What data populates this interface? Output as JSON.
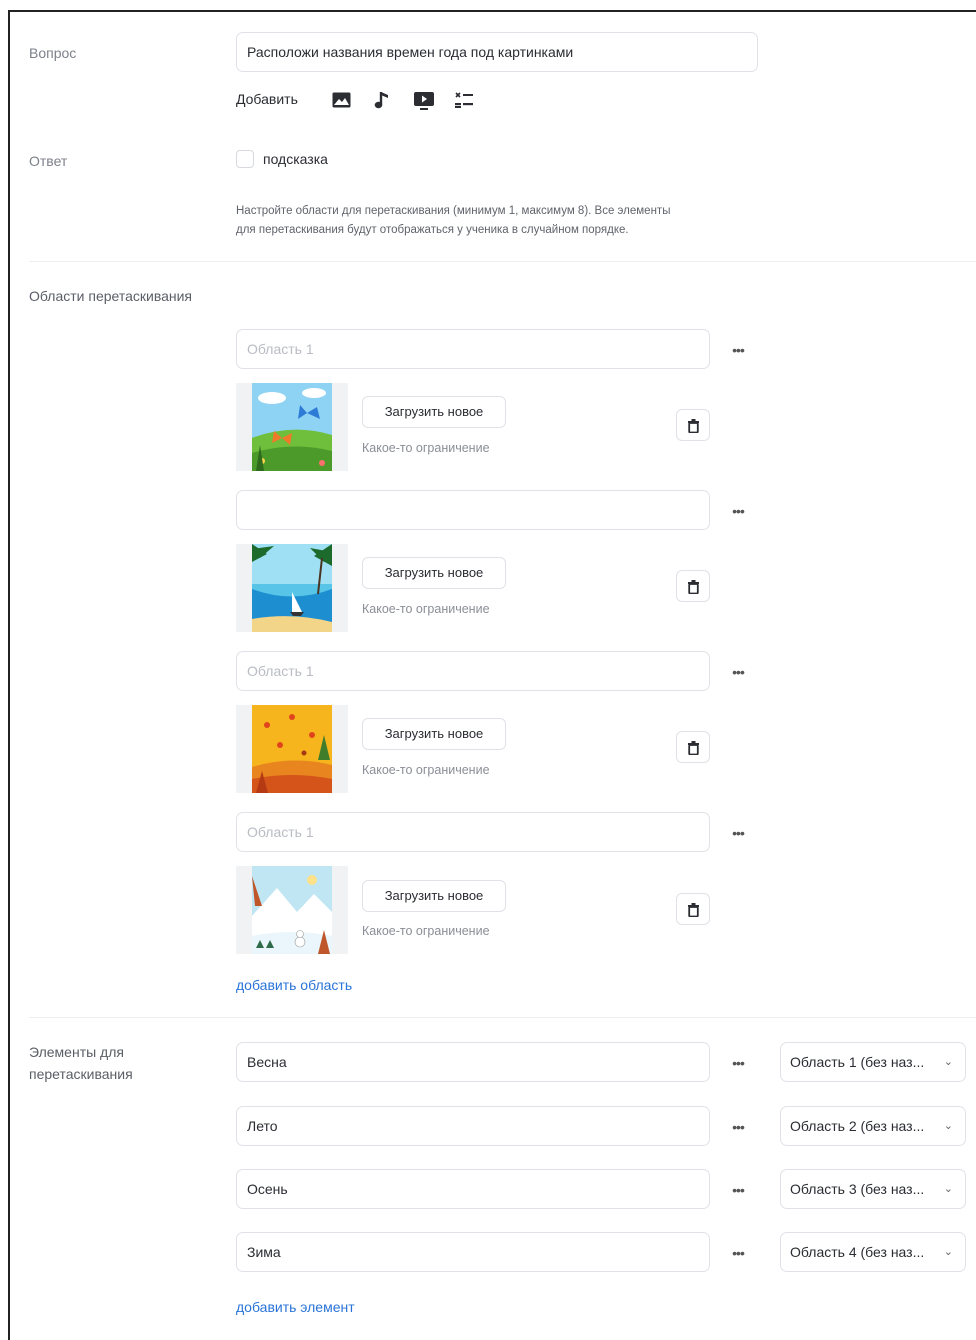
{
  "question": {
    "label": "Вопрос",
    "value": "Расположи названия времен года под картинками",
    "add_label": "Добавить",
    "add_icons": [
      "image-icon",
      "music-note-icon",
      "video-icon",
      "gap-icon"
    ]
  },
  "answer": {
    "label": "Ответ",
    "hint_checkbox_label": "подсказка",
    "hint_checked": false,
    "description": [
      "Настройте области для перетаскивания (минимум 1, максимум 8). Все элементы",
      "для перетаскивания будут отображаться у ученика в случайном порядке."
    ]
  },
  "drop_areas": {
    "label": "Области перетаскивания",
    "upload_label": "Загрузить новое",
    "constraint_label": "Какое-то ограничение",
    "add_link": "добавить область",
    "items": [
      {
        "value": "",
        "placeholder": "Область 1",
        "image": "spring-meadow-butterflies"
      },
      {
        "value": "",
        "placeholder": "",
        "image": "summer-sea-sailboat"
      },
      {
        "value": "",
        "placeholder": "Область 1",
        "image": "autumn-falling-leaves"
      },
      {
        "value": "",
        "placeholder": "Область 1",
        "image": "winter-snowy-landscape"
      }
    ]
  },
  "drag_elements": {
    "label_line1": "Элементы для",
    "label_line2": "перетаскивания",
    "add_link": "добавить элемент",
    "items": [
      {
        "value": "Весна",
        "target": "Область 1 (без наз..."
      },
      {
        "value": "Лето",
        "target": "Область 2 (без наз..."
      },
      {
        "value": "Осень",
        "target": "Область 3 (без наз..."
      },
      {
        "value": "Зима",
        "target": "Область 4 (без наз..."
      }
    ]
  },
  "colors": {
    "link": "#2a74d9",
    "border": "#e0e2e7",
    "label": "#7d818a"
  }
}
